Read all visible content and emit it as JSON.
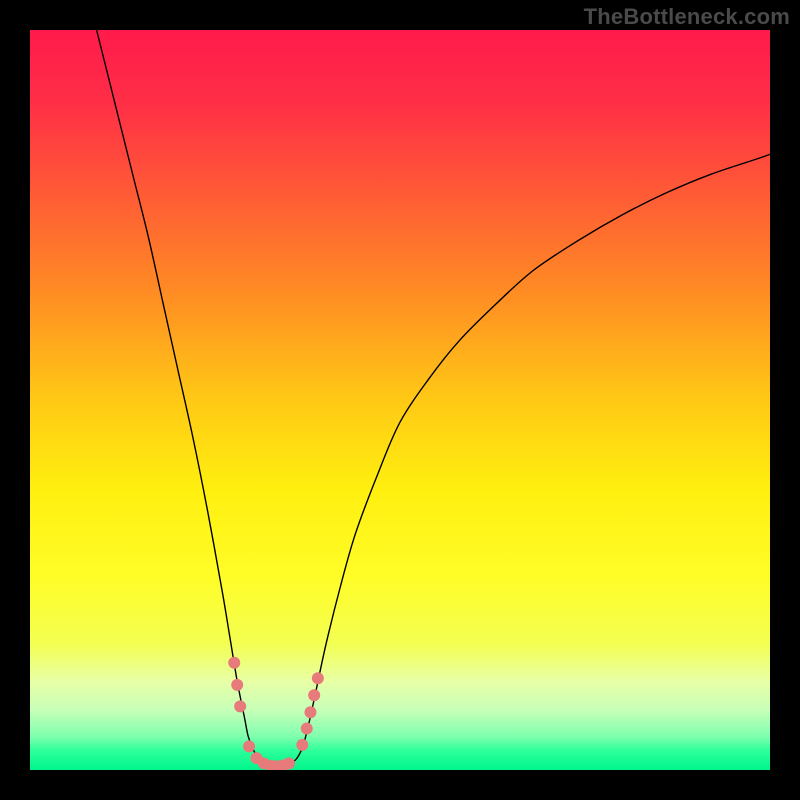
{
  "watermark": "TheBottleneck.com",
  "chart_data": {
    "type": "line",
    "title": "",
    "xlabel": "",
    "ylabel": "",
    "xlim": [
      0,
      100
    ],
    "ylim": [
      0,
      100
    ],
    "legend": false,
    "grid": false,
    "background_gradient": {
      "stops": [
        {
          "pos": 0.0,
          "color": "#ff1a4b"
        },
        {
          "pos": 0.1,
          "color": "#ff2f46"
        },
        {
          "pos": 0.22,
          "color": "#ff5a36"
        },
        {
          "pos": 0.35,
          "color": "#ff8a24"
        },
        {
          "pos": 0.5,
          "color": "#ffc915"
        },
        {
          "pos": 0.62,
          "color": "#ffef0f"
        },
        {
          "pos": 0.74,
          "color": "#fffd28"
        },
        {
          "pos": 0.83,
          "color": "#f3ff52"
        },
        {
          "pos": 0.88,
          "color": "#e8ffa6"
        },
        {
          "pos": 0.92,
          "color": "#c6ffb8"
        },
        {
          "pos": 0.955,
          "color": "#7dffad"
        },
        {
          "pos": 0.975,
          "color": "#2aff9a"
        },
        {
          "pos": 1.0,
          "color": "#00f58c"
        }
      ]
    },
    "series": [
      {
        "name": "bottleneck-curve",
        "color": "#000000",
        "width": 1.4,
        "x": [
          9,
          10,
          12,
          14,
          16,
          18,
          20,
          22,
          24,
          26,
          27,
          28,
          29,
          29.5,
          30.2,
          31.0,
          32.0,
          33.0,
          34.0,
          35.0,
          36.0,
          36.8,
          37.5,
          38.5,
          40,
          42,
          44,
          47,
          50,
          54,
          58,
          63,
          68,
          74,
          80,
          86,
          92,
          98,
          100
        ],
        "y": [
          100,
          96,
          88,
          80,
          72,
          63,
          54,
          45,
          35,
          24,
          18,
          12,
          7,
          4.5,
          2.7,
          1.5,
          0.8,
          0.5,
          0.5,
          0.8,
          1.5,
          3.0,
          5.5,
          10,
          17,
          25,
          32,
          40,
          47,
          53,
          58,
          63,
          67.5,
          71.5,
          75,
          78,
          80.5,
          82.5,
          83.2
        ]
      }
    ],
    "highlight_points": {
      "color": "#e77a7a",
      "radius": 6,
      "points": [
        {
          "x": 27.6,
          "y": 14.5
        },
        {
          "x": 28.0,
          "y": 11.5
        },
        {
          "x": 28.4,
          "y": 8.6
        },
        {
          "x": 29.6,
          "y": 3.2
        },
        {
          "x": 30.6,
          "y": 1.6
        },
        {
          "x": 31.6,
          "y": 0.9
        },
        {
          "x": 32.6,
          "y": 0.55
        },
        {
          "x": 33.4,
          "y": 0.5
        },
        {
          "x": 34.2,
          "y": 0.6
        },
        {
          "x": 35.0,
          "y": 0.9
        },
        {
          "x": 36.8,
          "y": 3.4
        },
        {
          "x": 37.4,
          "y": 5.6
        },
        {
          "x": 37.9,
          "y": 7.8
        },
        {
          "x": 38.4,
          "y": 10.1
        },
        {
          "x": 38.9,
          "y": 12.4
        }
      ]
    }
  }
}
